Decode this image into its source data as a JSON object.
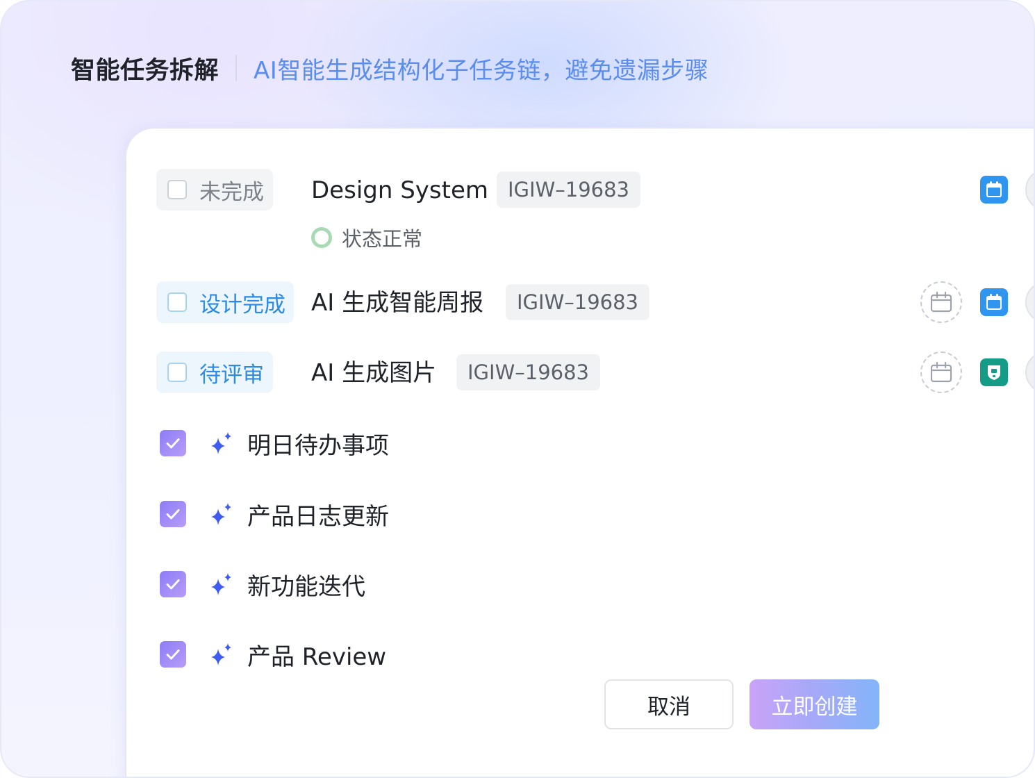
{
  "header": {
    "title": "智能任务拆解",
    "subtitle": "AI智能生成结构化子任务链，避免遗漏步骤"
  },
  "tasks": [
    {
      "status_label": "未完成",
      "title": "Design System",
      "id": "IGIW–19683",
      "sub_status": "状态正常",
      "app_icon": "calendar-app-icon"
    },
    {
      "status_label": "设计完成",
      "title": "AI 生成智能周报",
      "id": "IGIW–19683",
      "date_icon": "calendar-outline-icon",
      "app_icon": "calendar-app-icon"
    },
    {
      "status_label": "待评审",
      "title": "AI 生成图片",
      "id": "IGIW–19683",
      "date_icon": "calendar-outline-icon",
      "app_icon": "badge-app-icon"
    }
  ],
  "subtasks": [
    {
      "label": "明日待办事项",
      "checked": true
    },
    {
      "label": "产品日志更新",
      "checked": true
    },
    {
      "label": "新功能迭代",
      "checked": true
    },
    {
      "label": "产品 Review",
      "checked": true
    }
  ],
  "actions": {
    "cancel_label": "取消",
    "create_label": "立即创建"
  },
  "colors": {
    "accent_blue": "#5b8def",
    "status_blue": "#2b8be6",
    "check_purple": "#8d7cf6",
    "sparkle_blue": "#3f5bf2",
    "ok_green": "#a8dbb4",
    "app_blue": "#2f95ee",
    "app_teal": "#149c86"
  }
}
